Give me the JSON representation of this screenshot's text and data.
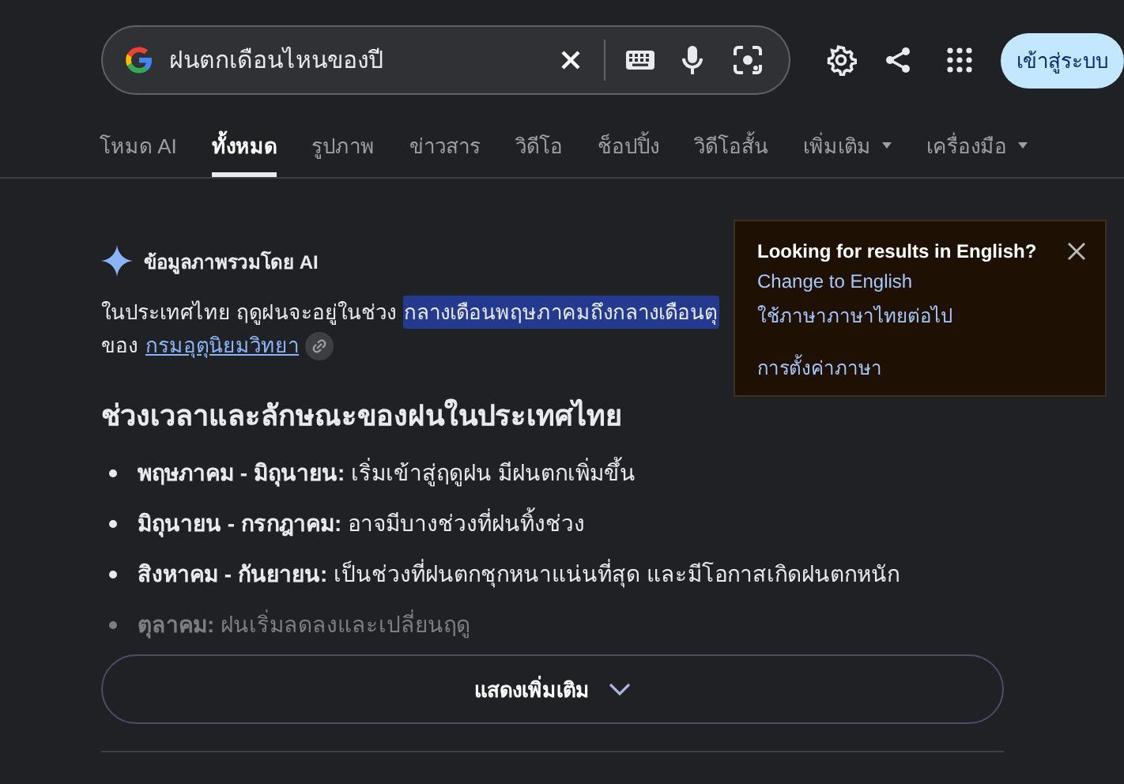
{
  "search": {
    "value": "ฝนตกเดือนไหนของปี"
  },
  "sign_in": "เข้าสู่ระบบ",
  "tabs": [
    {
      "label": "โหมด AI",
      "selected": false,
      "dropdown": false
    },
    {
      "label": "ทั้งหมด",
      "selected": true,
      "dropdown": false
    },
    {
      "label": "รูปภาพ",
      "selected": false,
      "dropdown": false
    },
    {
      "label": "ข่าวสาร",
      "selected": false,
      "dropdown": false
    },
    {
      "label": "วิดีโอ",
      "selected": false,
      "dropdown": false
    },
    {
      "label": "ช็อปปิ้ง",
      "selected": false,
      "dropdown": false
    },
    {
      "label": "วิดีโอสั้น",
      "selected": false,
      "dropdown": false
    },
    {
      "label": "เพิ่มเติม",
      "selected": false,
      "dropdown": true
    },
    {
      "label": "เครื่องมือ",
      "selected": false,
      "dropdown": true
    }
  ],
  "ai_overview": {
    "title": "ข้อมูลภาพรวมโดย AI",
    "intro": "ในประเทศไทย ฤดูฝนจะอยู่ในช่วง",
    "highlight": "กลางเดือนพฤษภาคมถึงกลางเดือนตุ",
    "source_prefix": "ของ",
    "source_link": "กรมอุตุนิยมวิทยา",
    "heading": "ช่วงเวลาและลักษณะของฝนในประเทศไทย",
    "bullets": [
      {
        "text": "**พฤษภาคม - มิถุนายน:** เริ่มเข้าสู่ฤดูฝน มีฝนตกเพิ่มขึ้น",
        "faded": false
      },
      {
        "text": "**มิถุนายน - กรกฎาคม:** อาจมีบางช่วงที่ฝนทิ้งช่วง",
        "faded": false
      },
      {
        "text": "**สิงหาคม - กันยายน:** เป็นช่วงที่ฝนตกชุกหนาแน่นที่สุด และมีโอกาสเกิดฝนตกหนัก",
        "faded": false
      },
      {
        "text": "**ตุลาคม:** ฝนเริ่มลดลงและเปลี่ยนฤดู",
        "faded": true
      }
    ],
    "show_more": "แสดงเพิ่มเติม"
  },
  "language_popup": {
    "title": "Looking for results in English?",
    "links": [
      "Change to English",
      "ใช้ภาษาภาษาไทยต่อไป",
      "การตั้งค่าภาษา"
    ]
  }
}
